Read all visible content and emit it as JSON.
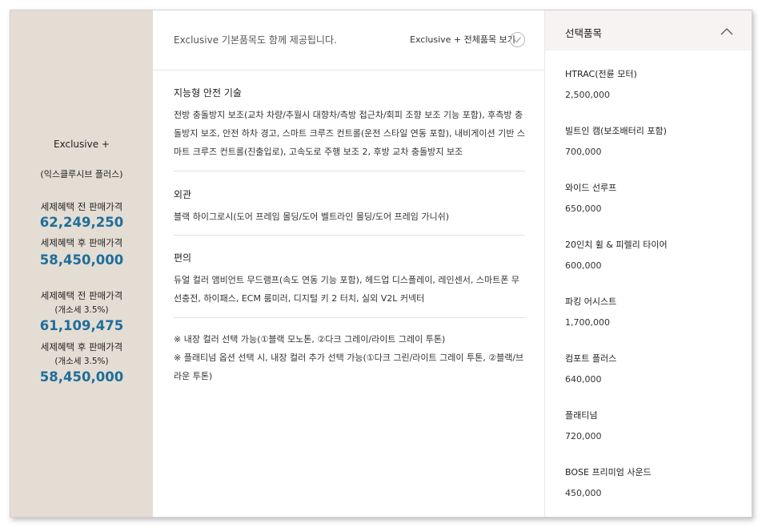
{
  "trim": {
    "name": "Exclusive +",
    "korean_name": "(익스클루시브 플러스)",
    "prices": [
      {
        "label": "세제혜택 전 판매가격",
        "value": "62,249,250"
      },
      {
        "label": "세제혜택 후 판매가격",
        "value": "58,450,000"
      },
      {
        "label": "세제혜택 전 판매가격",
        "tax_note": "(개소세 3.5%)",
        "value": "61,109,475"
      },
      {
        "label": "세제혜택 후 판매가격",
        "tax_note": "(개소세 3.5%)",
        "value": "58,450,000"
      }
    ]
  },
  "middle": {
    "note": "Exclusive 기본품목도 함께 제공됩니다.",
    "view_all_label": "Exclusive + 전체품목 보기",
    "check_icon": "check-circle-icon",
    "sections": [
      {
        "title": "지능형 안전 기술",
        "body": "전방 충돌방지 보조(교차 차량/추월시 대향차/측방 접근차/회피 조향 보조 기능 포함), 후측방 충돌방지 보조, 안전 하차 경고, 스마트 크루즈 컨트롤(운전 스타일 연동 포함), 내비게이션 기반 스마트 크루즈 컨트롤(진출입로), 고속도로 주행 보조 2, 후방 교차 충돌방지 보조"
      },
      {
        "title": "외관",
        "body": "블랙 하이그로시(도어 프레임 몰딩/도어 벨트라인 몰딩/도어 프레임 가니쉬)"
      },
      {
        "title": "편의",
        "body": "듀얼 컬러 앰비언트 무드램프(속도 연동 기능 포함), 헤드업 디스플레이, 레인센서, 스마트폰 무선충전, 하이패스, ECM 룸미러, 디지털 키 2 터치, 실외 V2L 커넥터"
      }
    ],
    "notes": [
      "※ 내장 컬러 선택 가능(①블랙 모노톤, ②다크 그레이/라이트 그레이 투톤)",
      "※ 플래티넘 옵션 선택 시, 내장 컬러 추가 선택 가능(①다크 그린/라이트 그레이 투톤, ②블랙/브라운 투톤)"
    ]
  },
  "options_panel": {
    "title": "선택품목",
    "collapse_icon": "chevron-up-icon",
    "items": [
      {
        "name": "HTRAC(전륜 모터)",
        "price": "2,500,000"
      },
      {
        "name": "빌트인 캠(보조배터리 포함)",
        "price": "700,000"
      },
      {
        "name": "와이드 선루프",
        "price": "650,000"
      },
      {
        "name": "20인치 휠 & 피렐리 타이어",
        "price": "600,000"
      },
      {
        "name": "파킹 어시스트",
        "price": "1,700,000"
      },
      {
        "name": "컴포트 플러스",
        "price": "640,000"
      },
      {
        "name": "플래티넘",
        "price": "720,000"
      },
      {
        "name": "BOSE 프리미엄 사운드",
        "price": "450,000"
      }
    ]
  },
  "colors": {
    "left_panel_bg": "#e4ddd4",
    "price_blue": "#1f6e9a",
    "right_header_bg": "#f6f3f2"
  }
}
